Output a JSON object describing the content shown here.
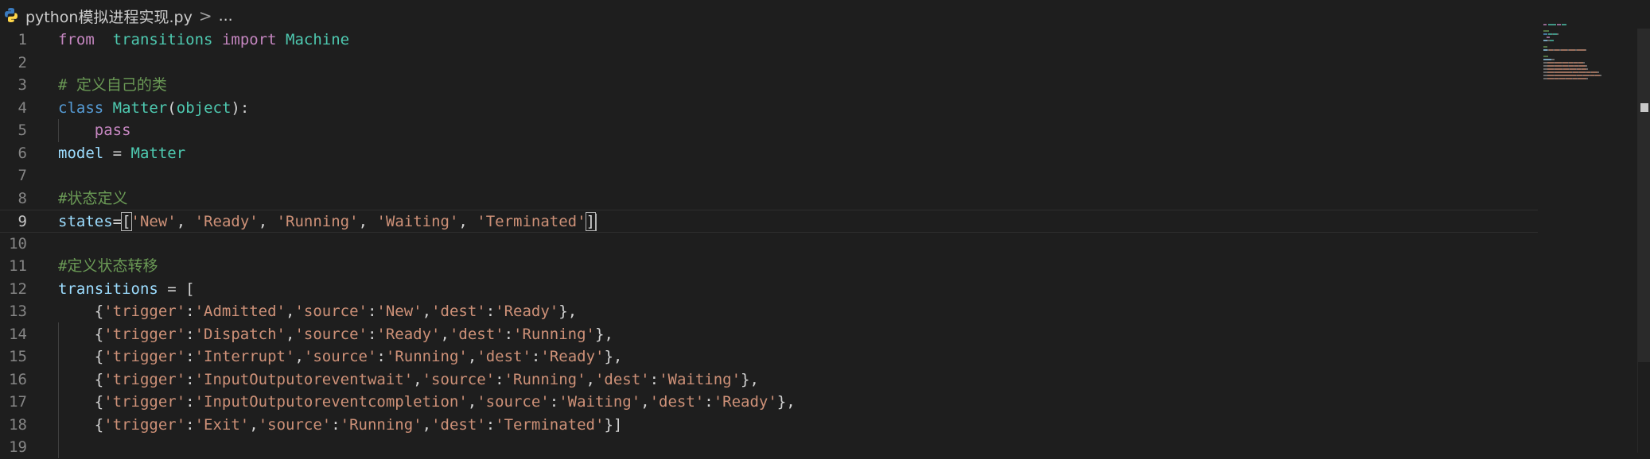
{
  "breadcrumb": {
    "file_name": "python模拟进程实现.py",
    "separator": ">",
    "more": "..."
  },
  "editor": {
    "language": "python",
    "current_line": 9,
    "lines": [
      {
        "n": "1",
        "tokens": [
          [
            "kw",
            "from"
          ],
          [
            "",
            "  "
          ],
          [
            "cls",
            "transitions"
          ],
          [
            "",
            " "
          ],
          [
            "kw",
            "import"
          ],
          [
            "",
            " "
          ],
          [
            "cls",
            "Machine"
          ]
        ]
      },
      {
        "n": "2",
        "tokens": []
      },
      {
        "n": "3",
        "tokens": [
          [
            "cmt",
            "# 定义自己的类"
          ]
        ]
      },
      {
        "n": "4",
        "tokens": [
          [
            "kw2",
            "class"
          ],
          [
            "",
            " "
          ],
          [
            "cls",
            "Matter"
          ],
          [
            "",
            "("
          ],
          [
            "cls",
            "object"
          ],
          [
            "",
            "):"
          ]
        ]
      },
      {
        "n": "5",
        "tokens": [
          [
            "",
            "    "
          ],
          [
            "kw",
            "pass"
          ]
        ]
      },
      {
        "n": "6",
        "tokens": [
          [
            "var",
            "model"
          ],
          [
            "",
            " = "
          ],
          [
            "cls",
            "Matter"
          ]
        ]
      },
      {
        "n": "7",
        "tokens": []
      },
      {
        "n": "8",
        "tokens": [
          [
            "cmt",
            "#状态定义"
          ]
        ]
      },
      {
        "n": "9",
        "tokens": [
          [
            "var",
            "states"
          ],
          [
            "",
            "="
          ],
          [
            "",
            "["
          ],
          [
            "str",
            "'New'"
          ],
          [
            "",
            ", "
          ],
          [
            "str",
            "'Ready'"
          ],
          [
            "",
            ", "
          ],
          [
            "str",
            "'Running'"
          ],
          [
            "",
            ", "
          ],
          [
            "str",
            "'Waiting'"
          ],
          [
            "",
            ", "
          ],
          [
            "str",
            "'Terminated'"
          ],
          [
            "",
            "]"
          ]
        ]
      },
      {
        "n": "10",
        "tokens": []
      },
      {
        "n": "11",
        "tokens": [
          [
            "cmt",
            "#定义状态转移"
          ]
        ]
      },
      {
        "n": "12",
        "tokens": [
          [
            "var",
            "transitions"
          ],
          [
            "",
            " = ["
          ]
        ]
      },
      {
        "n": "13",
        "tokens": [
          [
            "",
            "    {"
          ],
          [
            "str",
            "'trigger'"
          ],
          [
            "",
            ":"
          ],
          [
            "str",
            "'Admitted'"
          ],
          [
            "",
            ","
          ],
          [
            "str",
            "'source'"
          ],
          [
            "",
            ":"
          ],
          [
            "str",
            "'New'"
          ],
          [
            "",
            ","
          ],
          [
            "str",
            "'dest'"
          ],
          [
            "",
            ":"
          ],
          [
            "str",
            "'Ready'"
          ],
          [
            "",
            "},"
          ]
        ]
      },
      {
        "n": "14",
        "tokens": [
          [
            "",
            "    {"
          ],
          [
            "str",
            "'trigger'"
          ],
          [
            "",
            ":"
          ],
          [
            "str",
            "'Dispatch'"
          ],
          [
            "",
            ","
          ],
          [
            "str",
            "'source'"
          ],
          [
            "",
            ":"
          ],
          [
            "str",
            "'Ready'"
          ],
          [
            "",
            ","
          ],
          [
            "str",
            "'dest'"
          ],
          [
            "",
            ":"
          ],
          [
            "str",
            "'Running'"
          ],
          [
            "",
            "},"
          ]
        ]
      },
      {
        "n": "15",
        "tokens": [
          [
            "",
            "    {"
          ],
          [
            "str",
            "'trigger'"
          ],
          [
            "",
            ":"
          ],
          [
            "str",
            "'Interrupt'"
          ],
          [
            "",
            ","
          ],
          [
            "str",
            "'source'"
          ],
          [
            "",
            ":"
          ],
          [
            "str",
            "'Running'"
          ],
          [
            "",
            ","
          ],
          [
            "str",
            "'dest'"
          ],
          [
            "",
            ":"
          ],
          [
            "str",
            "'Ready'"
          ],
          [
            "",
            "},"
          ]
        ]
      },
      {
        "n": "16",
        "tokens": [
          [
            "",
            "    {"
          ],
          [
            "str",
            "'trigger'"
          ],
          [
            "",
            ":"
          ],
          [
            "str",
            "'InputOutputoreventwait'"
          ],
          [
            "",
            ","
          ],
          [
            "str",
            "'source'"
          ],
          [
            "",
            ":"
          ],
          [
            "str",
            "'Running'"
          ],
          [
            "",
            ","
          ],
          [
            "str",
            "'dest'"
          ],
          [
            "",
            ":"
          ],
          [
            "str",
            "'Waiting'"
          ],
          [
            "",
            "},"
          ]
        ]
      },
      {
        "n": "17",
        "tokens": [
          [
            "",
            "    {"
          ],
          [
            "str",
            "'trigger'"
          ],
          [
            "",
            ":"
          ],
          [
            "str",
            "'InputOutputoreventcompletion'"
          ],
          [
            "",
            ","
          ],
          [
            "str",
            "'source'"
          ],
          [
            "",
            ":"
          ],
          [
            "str",
            "'Waiting'"
          ],
          [
            "",
            ","
          ],
          [
            "str",
            "'dest'"
          ],
          [
            "",
            ":"
          ],
          [
            "str",
            "'Ready'"
          ],
          [
            "",
            "},"
          ]
        ]
      },
      {
        "n": "18",
        "tokens": [
          [
            "",
            "    {"
          ],
          [
            "str",
            "'trigger'"
          ],
          [
            "",
            ":"
          ],
          [
            "str",
            "'Exit'"
          ],
          [
            "",
            ","
          ],
          [
            "str",
            "'source'"
          ],
          [
            "",
            ":"
          ],
          [
            "str",
            "'Running'"
          ],
          [
            "",
            ","
          ],
          [
            "str",
            "'dest'"
          ],
          [
            "",
            ":"
          ],
          [
            "str",
            "'Terminated'"
          ],
          [
            "",
            "}]"
          ]
        ]
      },
      {
        "n": "19",
        "tokens": []
      }
    ]
  },
  "colors": {
    "background": "#1e1e1e",
    "keyword": "#c586c0",
    "keyword_blue": "#569cd6",
    "class": "#4ec9b0",
    "variable": "#9cdcfe",
    "string": "#ce9178",
    "comment": "#6a9955"
  },
  "icons": {
    "file": "python-file-icon",
    "separator": "chevron-right-icon"
  }
}
